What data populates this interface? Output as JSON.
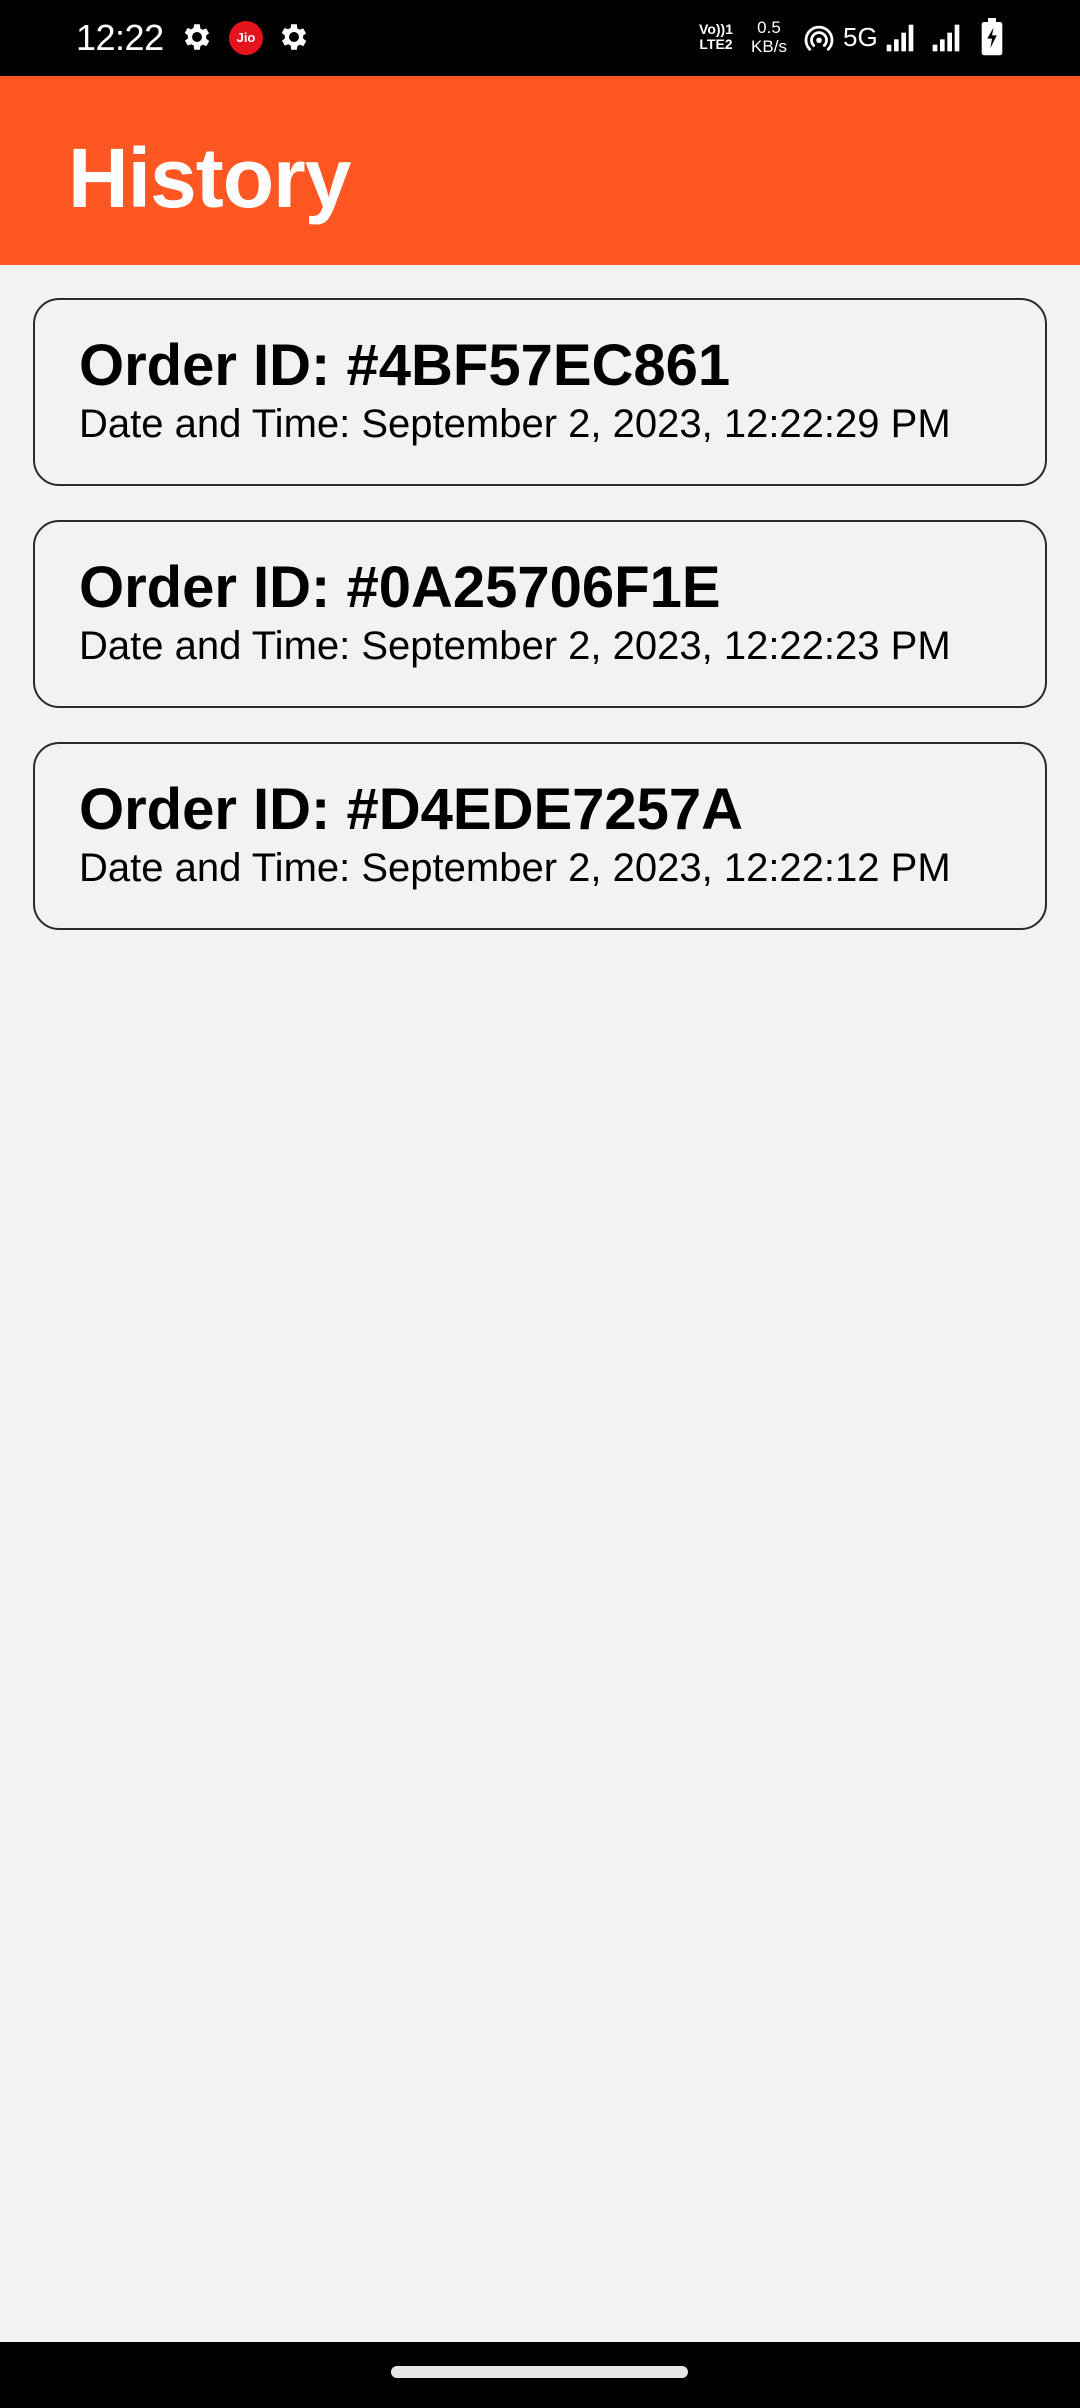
{
  "status_bar": {
    "time": "12:22",
    "carrier_badge": "Jio",
    "volte_line1": "Vo))1",
    "volte_line2": "LTE2",
    "speed_value": "0.5",
    "speed_unit": "KB/s",
    "network_type": "5G",
    "icons": [
      "gear-icon",
      "jio-icon",
      "gear-icon",
      "volte-icon",
      "hotspot-icon",
      "signal-icon",
      "signal-icon",
      "battery-charging-icon"
    ]
  },
  "app_bar": {
    "title": "History",
    "color": "#ff5722"
  },
  "orders": [
    {
      "id": "Order ID: #4BF57EC861",
      "datetime": "Date and Time: September 2, 2023, 12:22:29 PM"
    },
    {
      "id": "Order ID: #0A25706F1E",
      "datetime": "Date and Time: September 2, 2023, 12:22:23 PM"
    },
    {
      "id": "Order ID: #D4EDE7257A",
      "datetime": "Date and Time: September 2, 2023, 12:22:12 PM"
    }
  ]
}
